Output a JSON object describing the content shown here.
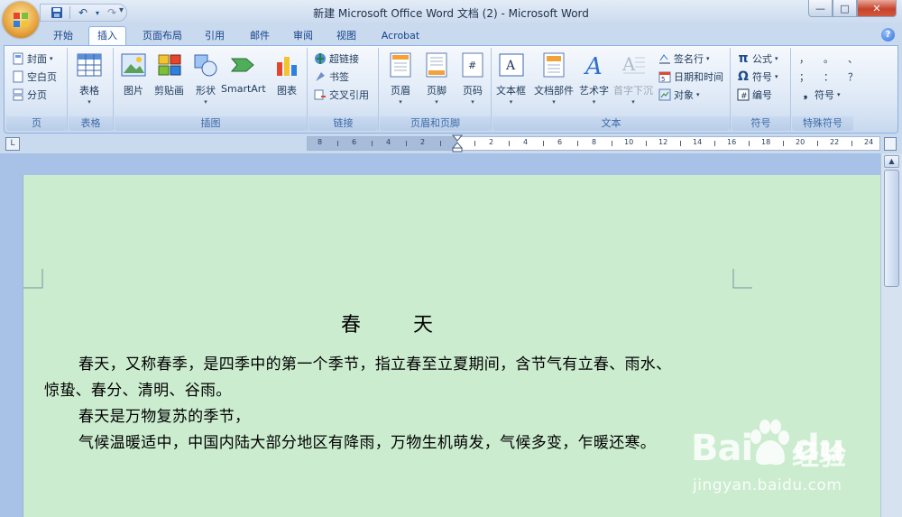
{
  "window": {
    "title": "新建 Microsoft Office Word 文档 (2) - Microsoft Word",
    "controls": {
      "minimize": "—",
      "maximize": "□",
      "close": "✕"
    }
  },
  "qat": {
    "save": "save-icon",
    "undo": "undo-icon",
    "redo": "redo-icon",
    "dropdown": "▾"
  },
  "tabs": [
    "开始",
    "插入",
    "页面布局",
    "引用",
    "邮件",
    "审阅",
    "视图",
    "Acrobat"
  ],
  "active_tab": "插入",
  "ribbon": {
    "pages": {
      "label": "页",
      "cover": "封面",
      "blank": "空白页",
      "break": "分页"
    },
    "tables": {
      "label": "表格",
      "table": "表格"
    },
    "illustrations": {
      "label": "插图",
      "picture": "图片",
      "clipart": "剪贴画",
      "shapes": "形状",
      "smartart": "SmartArt",
      "chart": "图表"
    },
    "links": {
      "label": "链接",
      "hyperlink": "超链接",
      "bookmark": "书签",
      "crossref": "交叉引用"
    },
    "header_footer": {
      "label": "页眉和页脚",
      "header": "页眉",
      "footer": "页脚",
      "page_number": "页码"
    },
    "text": {
      "label": "文本",
      "textbox": "文本框",
      "quickparts": "文档部件",
      "wordart": "艺术字",
      "dropcap": "首字下沉",
      "signature": "签名行",
      "datetime": "日期和时间",
      "object": "对象"
    },
    "symbols": {
      "label": "符号",
      "equation": "公式",
      "symbol": "符号",
      "number": "编号"
    },
    "special": {
      "label": "特殊符号",
      "row1": [
        "，",
        "。",
        "、"
      ],
      "row2": [
        "；",
        "：",
        "？"
      ],
      "symbol": "符号"
    }
  },
  "ruler": {
    "toggle": "L",
    "labels": [
      "8",
      "6",
      "4",
      "2",
      "2",
      "4",
      "6",
      "8",
      "10",
      "12",
      "14",
      "16",
      "18",
      "20",
      "22",
      "24"
    ]
  },
  "document": {
    "title_chars": [
      "春",
      "天"
    ],
    "lines": [
      "春天，又称春季，是四季中的第一个季节，指立春至立夏期间，含节气有立春、雨水、",
      "惊蛰、春分、清明、谷雨。",
      "春天是万物复苏的季节，",
      " 气候温暖适中，中国内陆大部分地区有降雨，万物生机萌发，气候多变，乍暖还寒。"
    ]
  },
  "watermark": {
    "brand": "Bai",
    "brand2": "du",
    "cn": "经验",
    "url": "jingyan.baidu.com"
  },
  "colors": {
    "page_bg": "#cbeccf",
    "ribbon_border": "#8db2e3",
    "tab_text": "#15428b"
  }
}
